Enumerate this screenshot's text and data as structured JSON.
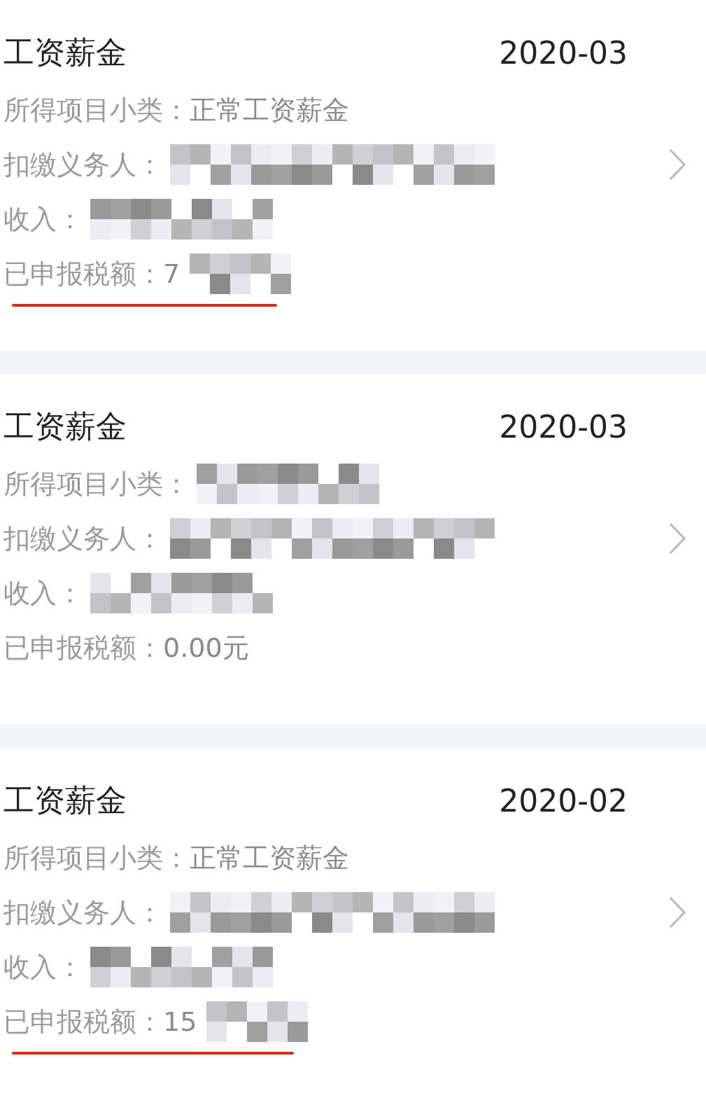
{
  "records": [
    {
      "title": "工资薪金",
      "period": "2020-03",
      "fields": [
        {
          "label": "所得项目小类：",
          "value": "正常工资薪金"
        },
        {
          "label": "扣缴义务人：",
          "redacted": true
        },
        {
          "label": "收入：",
          "redacted": true
        },
        {
          "label": "已申报税额：",
          "value": "7",
          "redacted": true,
          "underlined": true
        }
      ]
    },
    {
      "title": "工资薪金",
      "period": "2020-03",
      "fields": [
        {
          "label": "所得项目小类：",
          "redacted": true
        },
        {
          "label": "扣缴义务人：",
          "redacted": true
        },
        {
          "label": "收入：",
          "redacted": true
        },
        {
          "label": "已申报税额：",
          "value": "0.00元"
        }
      ]
    },
    {
      "title": "工资薪金",
      "period": "2020-02",
      "fields": [
        {
          "label": "所得项目小类：",
          "value": "正常工资薪金"
        },
        {
          "label": "扣缴义务人：",
          "redacted": true
        },
        {
          "label": "收入：",
          "redacted": true
        },
        {
          "label": "已申报税额：",
          "value": "15",
          "redacted": true,
          "underlined": true
        }
      ]
    }
  ]
}
